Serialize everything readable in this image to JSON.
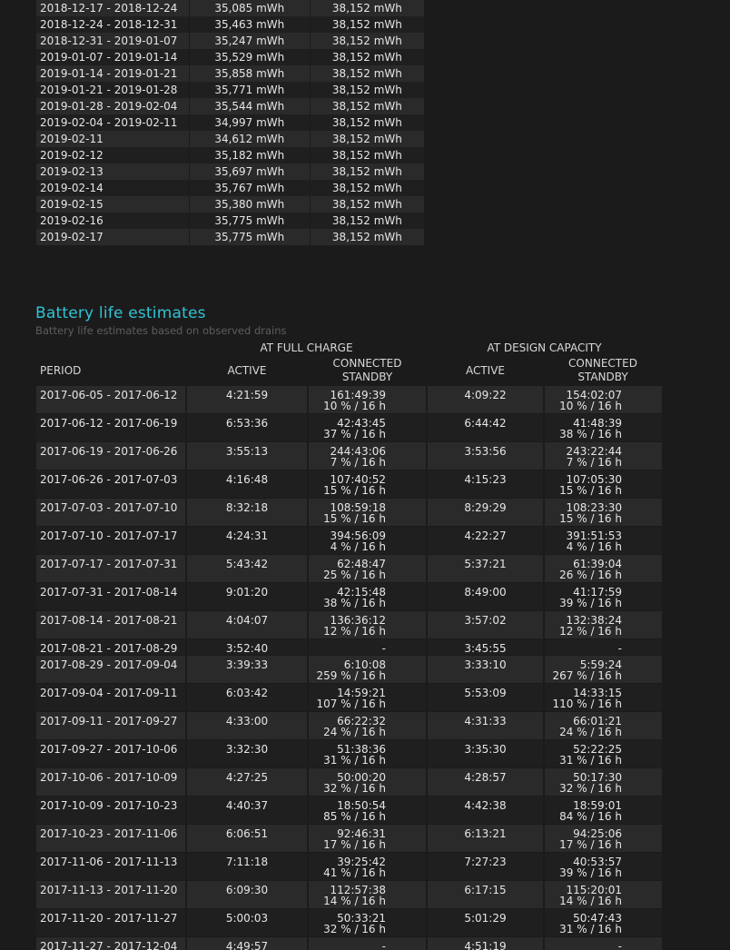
{
  "capacity_history": [
    {
      "period": "2018-12-17 - 2018-12-24",
      "full_charge": "35,085 mWh",
      "design": "38,152 mWh"
    },
    {
      "period": "2018-12-24 - 2018-12-31",
      "full_charge": "35,463 mWh",
      "design": "38,152 mWh"
    },
    {
      "period": "2018-12-31 - 2019-01-07",
      "full_charge": "35,247 mWh",
      "design": "38,152 mWh"
    },
    {
      "period": "2019-01-07 - 2019-01-14",
      "full_charge": "35,529 mWh",
      "design": "38,152 mWh"
    },
    {
      "period": "2019-01-14 - 2019-01-21",
      "full_charge": "35,858 mWh",
      "design": "38,152 mWh"
    },
    {
      "period": "2019-01-21 - 2019-01-28",
      "full_charge": "35,771 mWh",
      "design": "38,152 mWh"
    },
    {
      "period": "2019-01-28 - 2019-02-04",
      "full_charge": "35,544 mWh",
      "design": "38,152 mWh"
    },
    {
      "period": "2019-02-04 - 2019-02-11",
      "full_charge": "34,997 mWh",
      "design": "38,152 mWh"
    },
    {
      "period": "2019-02-11",
      "full_charge": "34,612 mWh",
      "design": "38,152 mWh"
    },
    {
      "period": "2019-02-12",
      "full_charge": "35,182 mWh",
      "design": "38,152 mWh"
    },
    {
      "period": "2019-02-13",
      "full_charge": "35,697 mWh",
      "design": "38,152 mWh"
    },
    {
      "period": "2019-02-14",
      "full_charge": "35,767 mWh",
      "design": "38,152 mWh"
    },
    {
      "period": "2019-02-15",
      "full_charge": "35,380 mWh",
      "design": "38,152 mWh"
    },
    {
      "period": "2019-02-16",
      "full_charge": "35,775 mWh",
      "design": "38,152 mWh"
    },
    {
      "period": "2019-02-17",
      "full_charge": "35,775 mWh",
      "design": "38,152 mWh"
    }
  ],
  "estimates": {
    "title": "Battery life estimates",
    "subtitle": "Battery life estimates based on observed drains",
    "group_full": "AT FULL CHARGE",
    "group_design": "AT DESIGN CAPACITY",
    "col_period": "PERIOD",
    "col_active": "ACTIVE",
    "col_standby_1": "CONNECTED",
    "col_standby_2": "STANDBY",
    "rows": [
      {
        "period": "2017-06-05 - 2017-06-12",
        "full_active": "4:21:59",
        "full_standby": "161:49:39",
        "full_standby_pct": "10 % / 16 h",
        "design_active": "4:09:22",
        "design_standby": "154:02:07",
        "design_standby_pct": "10 % / 16 h"
      },
      {
        "period": "2017-06-12 - 2017-06-19",
        "full_active": "6:53:36",
        "full_standby": "42:43:45",
        "full_standby_pct": "37 % / 16 h",
        "design_active": "6:44:42",
        "design_standby": "41:48:39",
        "design_standby_pct": "38 % / 16 h"
      },
      {
        "period": "2017-06-19 - 2017-06-26",
        "full_active": "3:55:13",
        "full_standby": "244:43:06",
        "full_standby_pct": "7 % / 16 h",
        "design_active": "3:53:56",
        "design_standby": "243:22:44",
        "design_standby_pct": "7 % / 16 h"
      },
      {
        "period": "2017-06-26 - 2017-07-03",
        "full_active": "4:16:48",
        "full_standby": "107:40:52",
        "full_standby_pct": "15 % / 16 h",
        "design_active": "4:15:23",
        "design_standby": "107:05:30",
        "design_standby_pct": "15 % / 16 h"
      },
      {
        "period": "2017-07-03 - 2017-07-10",
        "full_active": "8:32:18",
        "full_standby": "108:59:18",
        "full_standby_pct": "15 % / 16 h",
        "design_active": "8:29:29",
        "design_standby": "108:23:30",
        "design_standby_pct": "15 % / 16 h"
      },
      {
        "period": "2017-07-10 - 2017-07-17",
        "full_active": "4:24:31",
        "full_standby": "394:56:09",
        "full_standby_pct": "4 % / 16 h",
        "design_active": "4:22:27",
        "design_standby": "391:51:53",
        "design_standby_pct": "4 % / 16 h"
      },
      {
        "period": "2017-07-17 - 2017-07-31",
        "full_active": "5:43:42",
        "full_standby": "62:48:47",
        "full_standby_pct": "25 % / 16 h",
        "design_active": "5:37:21",
        "design_standby": "61:39:04",
        "design_standby_pct": "26 % / 16 h"
      },
      {
        "period": "2017-07-31 - 2017-08-14",
        "full_active": "9:01:20",
        "full_standby": "42:15:48",
        "full_standby_pct": "38 % / 16 h",
        "design_active": "8:49:00",
        "design_standby": "41:17:59",
        "design_standby_pct": "39 % / 16 h"
      },
      {
        "period": "2017-08-14 - 2017-08-21",
        "full_active": "4:04:07",
        "full_standby": "136:36:12",
        "full_standby_pct": "12 % / 16 h",
        "design_active": "3:57:02",
        "design_standby": "132:38:24",
        "design_standby_pct": "12 % / 16 h"
      },
      {
        "period": "2017-08-21 - 2017-08-29",
        "full_active": "3:52:40",
        "full_standby": "-",
        "full_standby_pct": "",
        "design_active": "3:45:55",
        "design_standby": "-",
        "design_standby_pct": ""
      },
      {
        "period": "2017-08-29 - 2017-09-04",
        "full_active": "3:39:33",
        "full_standby": "6:10:08",
        "full_standby_pct": "259 % / 16 h",
        "design_active": "3:33:10",
        "design_standby": "5:59:24",
        "design_standby_pct": "267 % / 16 h"
      },
      {
        "period": "2017-09-04 - 2017-09-11",
        "full_active": "6:03:42",
        "full_standby": "14:59:21",
        "full_standby_pct": "107 % / 16 h",
        "design_active": "5:53:09",
        "design_standby": "14:33:15",
        "design_standby_pct": "110 % / 16 h"
      },
      {
        "period": "2017-09-11 - 2017-09-27",
        "full_active": "4:33:00",
        "full_standby": "66:22:32",
        "full_standby_pct": "24 % / 16 h",
        "design_active": "4:31:33",
        "design_standby": "66:01:21",
        "design_standby_pct": "24 % / 16 h"
      },
      {
        "period": "2017-09-27 - 2017-10-06",
        "full_active": "3:32:30",
        "full_standby": "51:38:36",
        "full_standby_pct": "31 % / 16 h",
        "design_active": "3:35:30",
        "design_standby": "52:22:25",
        "design_standby_pct": "31 % / 16 h"
      },
      {
        "period": "2017-10-06 - 2017-10-09",
        "full_active": "4:27:25",
        "full_standby": "50:00:20",
        "full_standby_pct": "32 % / 16 h",
        "design_active": "4:28:57",
        "design_standby": "50:17:30",
        "design_standby_pct": "32 % / 16 h"
      },
      {
        "period": "2017-10-09 - 2017-10-23",
        "full_active": "4:40:37",
        "full_standby": "18:50:54",
        "full_standby_pct": "85 % / 16 h",
        "design_active": "4:42:38",
        "design_standby": "18:59:01",
        "design_standby_pct": "84 % / 16 h"
      },
      {
        "period": "2017-10-23 - 2017-11-06",
        "full_active": "6:06:51",
        "full_standby": "92:46:31",
        "full_standby_pct": "17 % / 16 h",
        "design_active": "6:13:21",
        "design_standby": "94:25:06",
        "design_standby_pct": "17 % / 16 h"
      },
      {
        "period": "2017-11-06 - 2017-11-13",
        "full_active": "7:11:18",
        "full_standby": "39:25:42",
        "full_standby_pct": "41 % / 16 h",
        "design_active": "7:27:23",
        "design_standby": "40:53:57",
        "design_standby_pct": "39 % / 16 h"
      },
      {
        "period": "2017-11-13 - 2017-11-20",
        "full_active": "6:09:30",
        "full_standby": "112:57:38",
        "full_standby_pct": "14 % / 16 h",
        "design_active": "6:17:15",
        "design_standby": "115:20:01",
        "design_standby_pct": "14 % / 16 h"
      },
      {
        "period": "2017-11-20 - 2017-11-27",
        "full_active": "5:00:03",
        "full_standby": "50:33:21",
        "full_standby_pct": "32 % / 16 h",
        "design_active": "5:01:29",
        "design_standby": "50:47:43",
        "design_standby_pct": "31 % / 16 h"
      },
      {
        "period": "2017-11-27 - 2017-12-04",
        "full_active": "4:49:57",
        "full_standby": "-",
        "full_standby_pct": "",
        "design_active": "4:51:19",
        "design_standby": "-",
        "design_standby_pct": ""
      }
    ]
  }
}
